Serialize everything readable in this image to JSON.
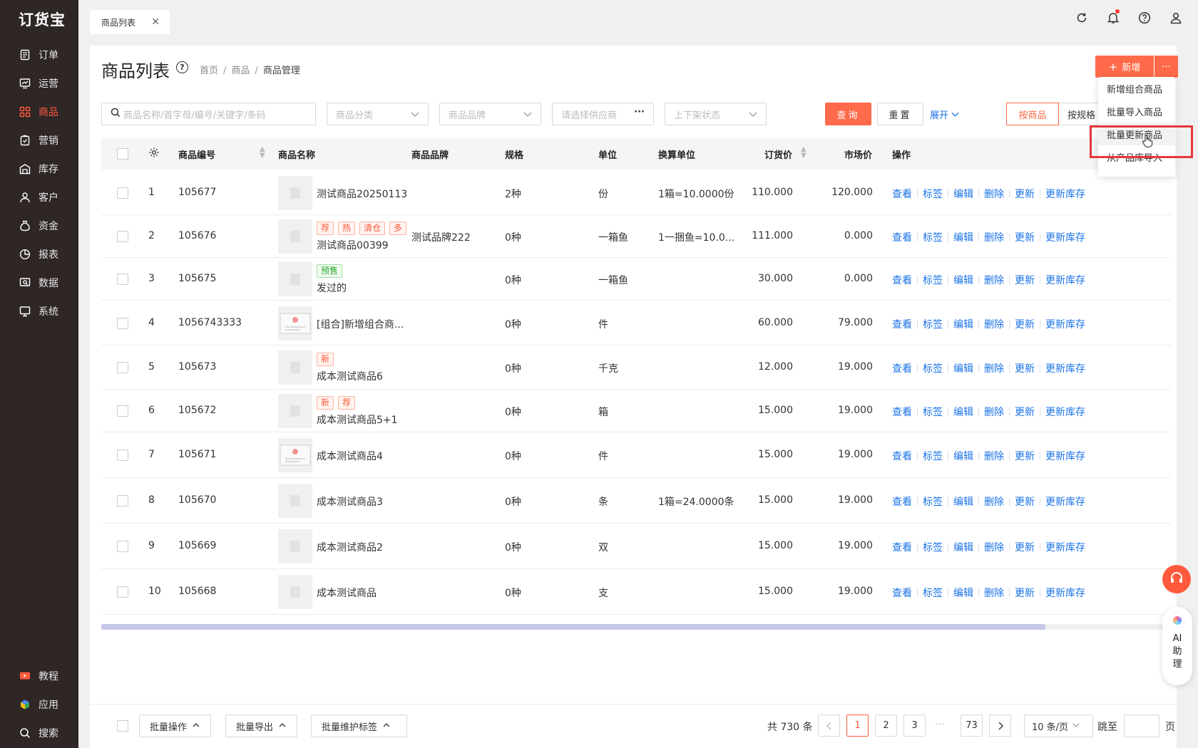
{
  "app": {
    "logo": "订货宝"
  },
  "sidebar": {
    "items": [
      {
        "label": "订单",
        "icon": "order-icon"
      },
      {
        "label": "运营",
        "icon": "chart-icon"
      },
      {
        "label": "商品",
        "icon": "grid-icon",
        "active": true
      },
      {
        "label": "营销",
        "icon": "marketing-icon"
      },
      {
        "label": "库存",
        "icon": "warehouse-icon"
      },
      {
        "label": "客户",
        "icon": "user-icon"
      },
      {
        "label": "资金",
        "icon": "money-bag-icon"
      },
      {
        "label": "报表",
        "icon": "pie-icon"
      },
      {
        "label": "数据",
        "icon": "data-search-icon"
      },
      {
        "label": "系统",
        "icon": "monitor-icon"
      }
    ],
    "bottom": [
      {
        "label": "教程",
        "icon": "video-icon"
      },
      {
        "label": "应用",
        "icon": "cube-icon"
      },
      {
        "label": "搜索",
        "icon": "search-icon"
      }
    ]
  },
  "topbar": {
    "tab_label": "商品列表"
  },
  "page": {
    "title": "商品列表",
    "breadcrumb": [
      "首页",
      "商品",
      "商品管理"
    ],
    "new_button": "新增",
    "more_button": "···"
  },
  "filters": {
    "search_placeholder": "商品名称/首字母/编号/关键字/条码",
    "category_placeholder": "商品分类",
    "brand_placeholder": "商品品牌",
    "supplier_placeholder": "请选择供应商",
    "status_placeholder": "上下架状态",
    "query_button": "查询",
    "reset_button": "重置",
    "expand_link": "展开",
    "by_product": "按商品",
    "by_spec": "按规格"
  },
  "table": {
    "headers": {
      "code": "商品编号",
      "name": "商品名称",
      "brand": "商品品牌",
      "spec": "规格",
      "unit": "单位",
      "conv": "换算单位",
      "order_price": "订货价",
      "market_price": "市场价",
      "ops": "操作"
    },
    "ops": [
      "查看",
      "标签",
      "编辑",
      "删除",
      "更新",
      "更新库存"
    ],
    "rows": [
      {
        "idx": "1",
        "code": "105677",
        "name": "测试商品20250113",
        "tags": [],
        "brand": "",
        "spec": "2种",
        "unit": "份",
        "conv": "1箱=10.0000份",
        "order_price": "110.000",
        "market_price": "120.000"
      },
      {
        "idx": "2",
        "code": "105676",
        "name": "测试商品00399",
        "tags": [
          "荐",
          "热",
          "清仓",
          "多"
        ],
        "brand": "测试品牌222",
        "spec": "0种",
        "unit": "一箱鱼",
        "conv": "1一捆鱼=10.0...",
        "order_price": "111.000",
        "market_price": "0.000"
      },
      {
        "idx": "3",
        "code": "105675",
        "name": "发过的",
        "tags": [
          "预售"
        ],
        "brand": "",
        "spec": "0种",
        "unit": "一箱鱼",
        "conv": "",
        "order_price": "30.000",
        "market_price": "0.000"
      },
      {
        "idx": "4",
        "code": "1056743333",
        "name": "[组合]新增组合商...",
        "tags": [],
        "brand": "",
        "spec": "0种",
        "unit": "件",
        "conv": "",
        "order_price": "60.000",
        "market_price": "79.000"
      },
      {
        "idx": "5",
        "code": "105673",
        "name": "成本测试商品6",
        "tags": [
          "新"
        ],
        "brand": "",
        "spec": "0种",
        "unit": "千克",
        "conv": "",
        "order_price": "12.000",
        "market_price": "19.000"
      },
      {
        "idx": "6",
        "code": "105672",
        "name": "成本测试商品5+1",
        "tags": [
          "新",
          "荐"
        ],
        "brand": "",
        "spec": "0种",
        "unit": "箱",
        "conv": "",
        "order_price": "15.000",
        "market_price": "19.000"
      },
      {
        "idx": "7",
        "code": "105671",
        "name": "成本测试商品4",
        "tags": [],
        "brand": "",
        "spec": "0种",
        "unit": "件",
        "conv": "",
        "order_price": "15.000",
        "market_price": "19.000"
      },
      {
        "idx": "8",
        "code": "105670",
        "name": "成本测试商品3",
        "tags": [],
        "brand": "",
        "spec": "0种",
        "unit": "条",
        "conv": "1箱=24.0000条",
        "order_price": "15.000",
        "market_price": "19.000"
      },
      {
        "idx": "9",
        "code": "105669",
        "name": "成本测试商品2",
        "tags": [],
        "brand": "",
        "spec": "0种",
        "unit": "双",
        "conv": "",
        "order_price": "15.000",
        "market_price": "19.000"
      },
      {
        "idx": "10",
        "code": "105668",
        "name": "成本测试商品",
        "tags": [],
        "brand": "",
        "spec": "0种",
        "unit": "支",
        "conv": "",
        "order_price": "15.000",
        "market_price": "19.000"
      }
    ]
  },
  "footer": {
    "batch_ops": "批量操作",
    "batch_export": "批量导出",
    "batch_tags": "批量维护标签",
    "total": "共 730 条",
    "pages": [
      "1",
      "2",
      "3"
    ],
    "ellipsis": "···",
    "last_page": "73",
    "page_size": "10 条/页",
    "jump_label": "跳至",
    "page_suffix": "页"
  },
  "dropdown": {
    "items": [
      "新增组合商品",
      "批量导入商品",
      "批量更新商品",
      "从产品库导入"
    ]
  },
  "ai": {
    "label": "AI助理"
  },
  "colors": {
    "accent": "#ff6a4a",
    "link": "#1a73e8",
    "sidebar": "#2f2626",
    "highlight": "#e5373a"
  }
}
